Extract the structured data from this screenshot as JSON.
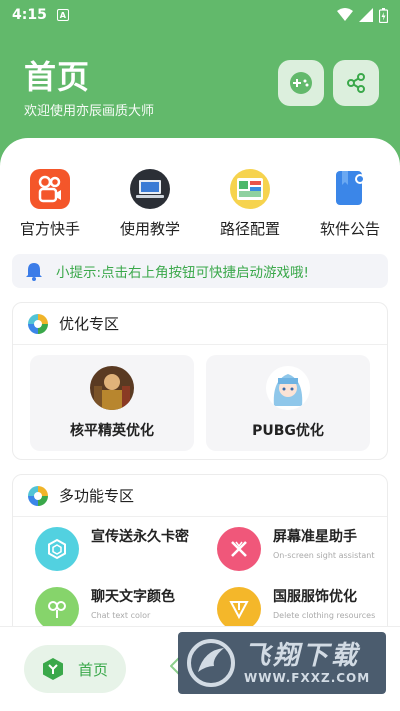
{
  "status": {
    "time": "4:15",
    "notif_letter": "A"
  },
  "header": {
    "title": "首页",
    "subtitle": "欢迎使用亦辰画质大师"
  },
  "quick_links": [
    {
      "label": "官方快手",
      "icon": "kuaishou-icon"
    },
    {
      "label": "使用教学",
      "icon": "laptop-icon"
    },
    {
      "label": "路径配置",
      "icon": "map-config-icon"
    },
    {
      "label": "软件公告",
      "icon": "notice-icon"
    }
  ],
  "tip": {
    "text": "小提示:点击右上角按钮可快捷启动游戏哦!"
  },
  "optimize": {
    "title": "优化专区",
    "tiles": [
      {
        "label": "核平精英优化"
      },
      {
        "label": "PUBG优化"
      }
    ]
  },
  "multi": {
    "title": "多功能专区",
    "features": [
      {
        "title": "宣传送永久卡密",
        "sub": "",
        "color": "#52d1e0"
      },
      {
        "title": "屏幕准星助手",
        "sub": "On-screen sight assistant",
        "color": "#f0577a"
      },
      {
        "title": "聊天文字颜色",
        "sub": "Chat text color",
        "color": "#86d46b"
      },
      {
        "title": "国服服饰优化",
        "sub": "Delete clothing resources",
        "color": "#f4b72a"
      }
    ]
  },
  "nav": {
    "home_label": "首页"
  },
  "watermark": {
    "main": "飞翔下载",
    "url": "WWW.FXXZ.COM"
  },
  "colors": {
    "primary": "#62b96b",
    "accent_text": "#3aa84a"
  }
}
